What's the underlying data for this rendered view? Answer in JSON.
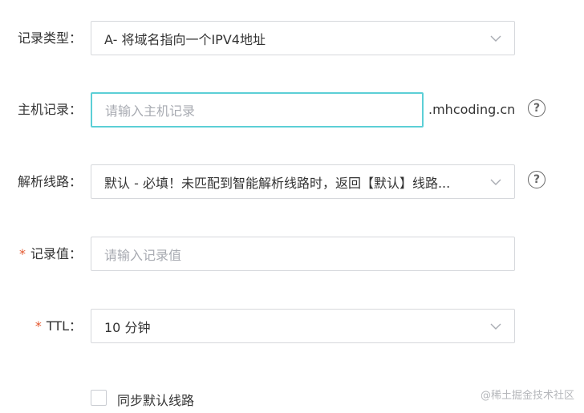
{
  "form": {
    "record_type": {
      "label": "记录类型：",
      "value": "A- 将域名指向一个IPV4地址"
    },
    "host_record": {
      "label": "主机记录：",
      "placeholder": "请输入主机记录",
      "suffix": ".mhcoding.cn",
      "help": "?"
    },
    "line": {
      "label": "解析线路：",
      "value": "默认 - 必填！未匹配到智能解析线路时，返回【默认】线路...",
      "help": "?"
    },
    "record_value": {
      "required_mark": "*",
      "label": "记录值：",
      "placeholder": "请输入记录值"
    },
    "ttl": {
      "required_mark": "*",
      "label": "TTL：",
      "value": "10 分钟"
    },
    "sync_default": {
      "label": "同步默认线路",
      "checked": false
    }
  },
  "watermark": "@稀土掘金技术社区",
  "colors": {
    "focus_border": "#5ccfd6",
    "required": "#e4572e",
    "border": "#d6d8dc",
    "placeholder": "#a8abb2"
  }
}
